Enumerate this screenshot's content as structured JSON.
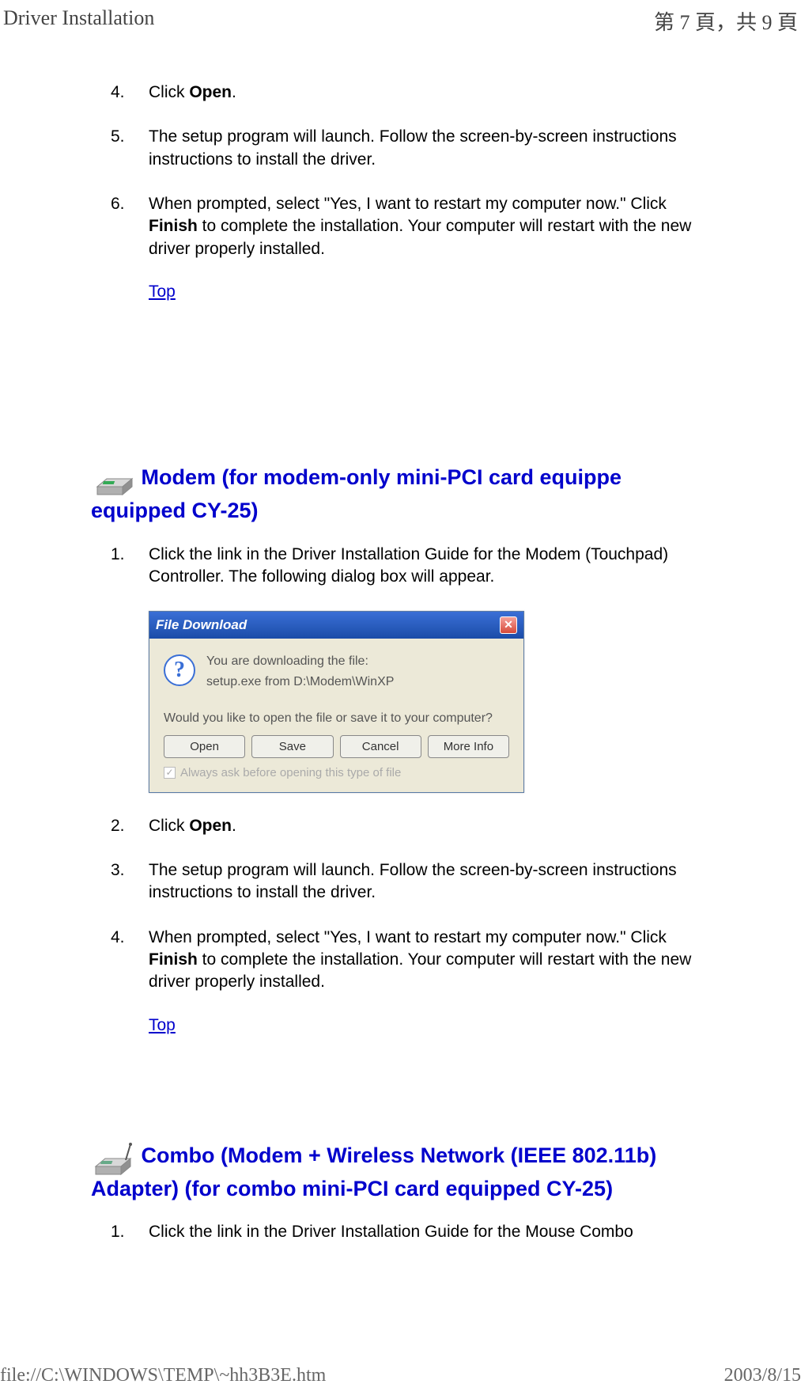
{
  "header": {
    "title": "Driver Installation",
    "page_indicator": "第 7 頁，共 9 頁"
  },
  "footer": {
    "path": "file://C:\\WINDOWS\\TEMP\\~hh3B3E.htm",
    "date": "2003/8/15"
  },
  "section_a": {
    "steps": [
      {
        "num": "4.",
        "text_before": "Click ",
        "bold": "Open",
        "text_after": "."
      },
      {
        "num": "5.",
        "text": "The setup program will launch. Follow the screen-by-screen instructions instructions to install the driver."
      },
      {
        "num": "6.",
        "text_before": "When prompted, select \"Yes, I want to restart my computer now.\" Click ",
        "bold": "Finish",
        "text_after": " to complete the installation. Your computer will restart with the new driver properly installed."
      }
    ],
    "top_link": "Top"
  },
  "section_b": {
    "heading": " Modem (for modem-only mini-PCI card equippe equipped CY-25)",
    "steps_before": [
      {
        "num": "1.",
        "text": "Click the link in the Driver Installation Guide for the Modem (Touchpad) Controller. The following dialog box will appear."
      }
    ],
    "dialog": {
      "title": "File Download",
      "line1": "You are downloading the file:",
      "line2": "setup.exe from D:\\Modem\\WinXP",
      "question": "Would you like to open the file or save it to your computer?",
      "buttons": {
        "open": "Open",
        "save": "Save",
        "cancel": "Cancel",
        "more": "More Info"
      },
      "checkbox_label": "Always ask before opening this type of file"
    },
    "steps_after": [
      {
        "num": "2.",
        "text_before": "Click ",
        "bold": "Open",
        "text_after": "."
      },
      {
        "num": "3.",
        "text": "The setup program will launch. Follow the screen-by-screen instructions instructions to install the driver."
      },
      {
        "num": "4.",
        "text_before": "When prompted, select \"Yes, I want to restart my computer now.\" Click ",
        "bold": "Finish",
        "text_after": " to complete the installation. Your computer will restart with the new driver properly installed."
      }
    ],
    "top_link": "Top"
  },
  "section_c": {
    "heading": " Combo (Modem + Wireless Network (IEEE 802.11b) Adapter) (for combo mini-PCI card equipped CY-25)",
    "steps": [
      {
        "num": "1.",
        "text": "Click the link in the Driver Installation Guide for the Mouse Combo"
      }
    ]
  }
}
